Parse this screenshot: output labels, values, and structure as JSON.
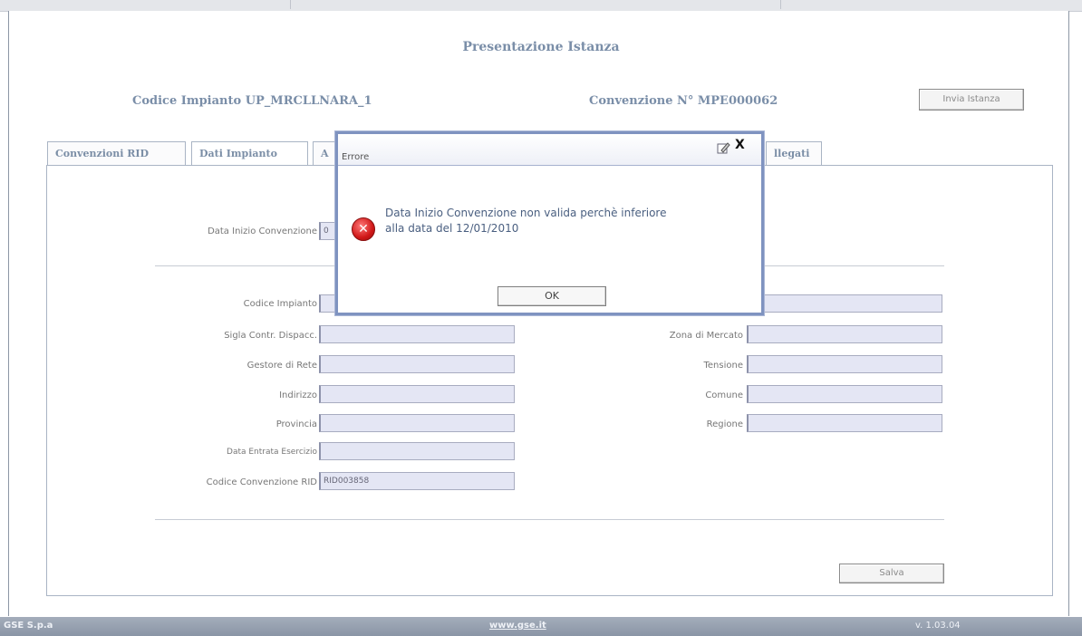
{
  "page": {
    "title": "Presentazione Istanza",
    "codice_impianto_label": "Codice Impianto UP_MRCLLNARA_1",
    "convenzione_label": "Convenzione N° MPE000062",
    "invia_button": "Invia Istanza"
  },
  "tabs": [
    {
      "label": "Convenzioni RID"
    },
    {
      "label": "Dati Impianto"
    },
    {
      "label": "A"
    },
    {
      "label": "llegati"
    }
  ],
  "form": {
    "data_inizio_label": "Data Inizio Convenzione",
    "data_inizio_value": "0",
    "left_fields": [
      {
        "label": "Codice Impianto",
        "value": ""
      },
      {
        "label": "Sigla Contr. Dispacc.",
        "value": ""
      },
      {
        "label": "Gestore di Rete",
        "value": ""
      },
      {
        "label": "Indirizzo",
        "value": ""
      },
      {
        "label": "Provincia",
        "value": ""
      },
      {
        "label": "Data Entrata Esercizio",
        "value": ""
      },
      {
        "label": "Codice Convenzione RID",
        "value": "RID003858"
      }
    ],
    "right_fields": [
      {
        "label": "Zona di Mercato",
        "value": ""
      },
      {
        "label": "Tensione",
        "value": ""
      },
      {
        "label": "Comune",
        "value": ""
      },
      {
        "label": "Regione",
        "value": ""
      }
    ],
    "salva_button": "Salva"
  },
  "dialog": {
    "title": "Errore",
    "message_line1": "Data Inizio Convenzione non valida perchè inferiore",
    "message_line2": "alla data del 12/01/2010",
    "ok_label": "OK",
    "close_glyph": "X"
  },
  "footer": {
    "company": "GSE S.p.a",
    "site": "www.gse.it",
    "version": "v. 1.03.04"
  },
  "colors": {
    "heading": "#7a8ea8",
    "field_bg": "#e4e6f4",
    "dialog_border": "#7f93c0",
    "error_red": "#d01818",
    "footer_bg": "#8a95a6"
  }
}
